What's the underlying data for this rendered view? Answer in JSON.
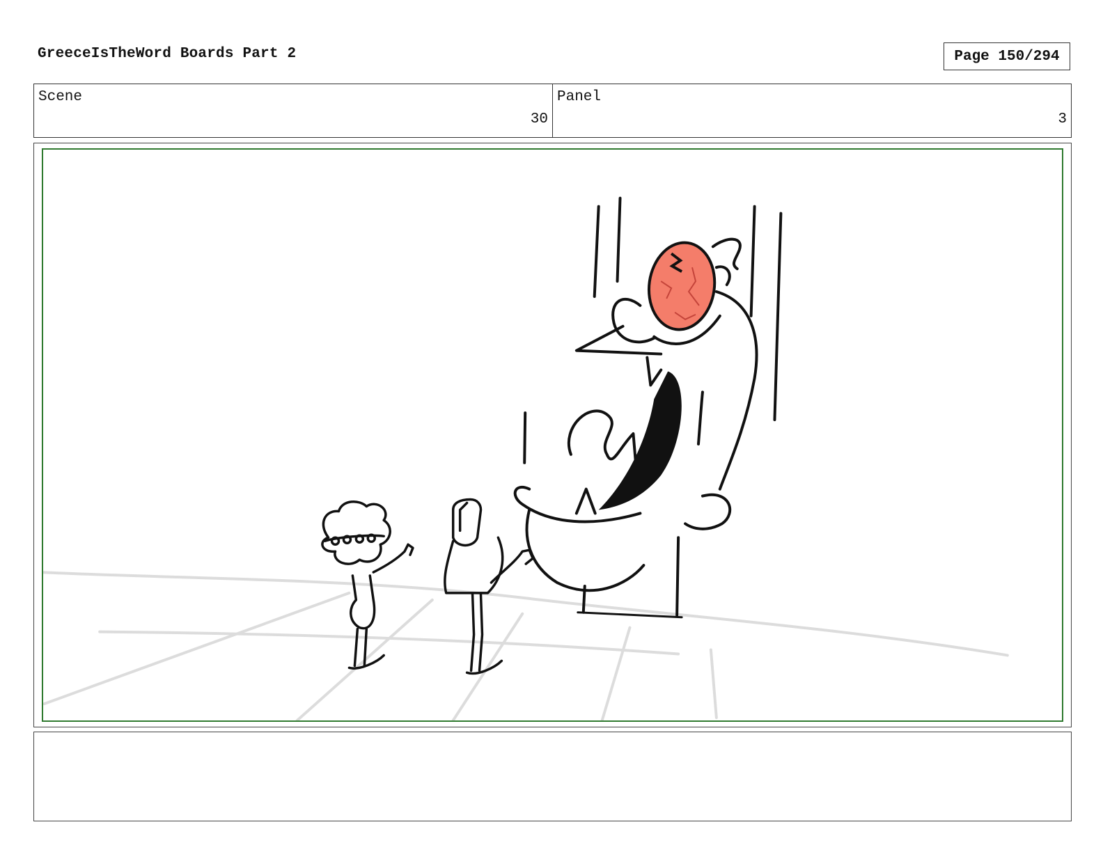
{
  "header": {
    "title": "GreeceIsTheWord Boards Part 2",
    "page_label": "Page 150/294"
  },
  "info": {
    "scene_label": "Scene",
    "scene_value": "30",
    "panel_label": "Panel",
    "panel_value": "3"
  },
  "colors": {
    "frame_border": "#2f7a2f",
    "bald_head": "#f47d6a",
    "head_vein": "#c4443a"
  },
  "notes": {
    "text": ""
  }
}
